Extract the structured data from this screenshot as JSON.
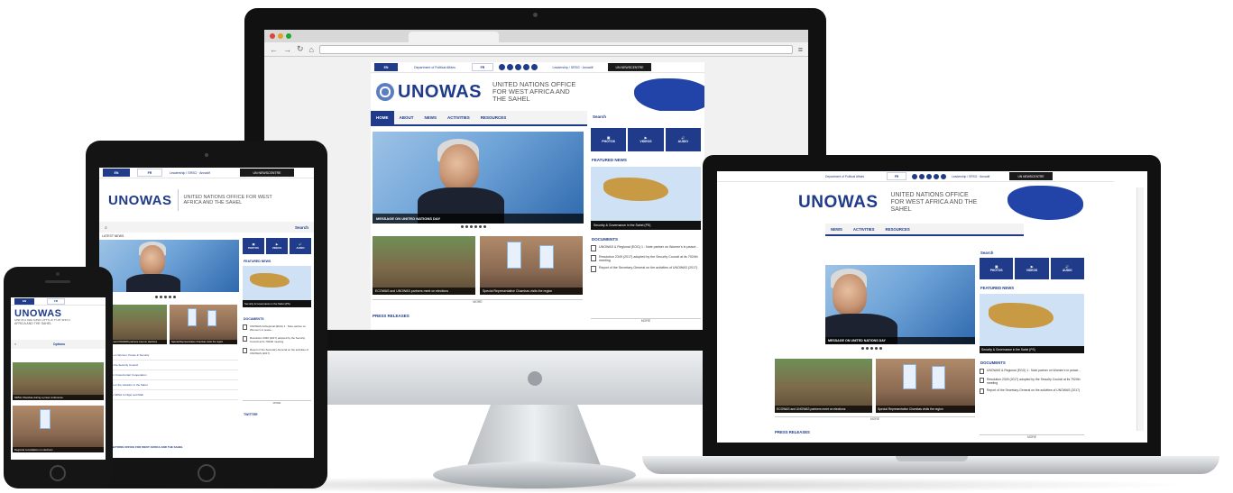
{
  "site": {
    "short_name": "UNOWAS",
    "full_name": "UNITED NATIONS OFFICE FOR WEST AFRICA AND THE SAHEL",
    "lang_en": "EN",
    "lang_fr": "FR",
    "leadership_link": "Leadership / SRSG · Annadif",
    "dark_button": "UN NEWSCENTRE",
    "relations_link": "Department of Political Affairs"
  },
  "nav": {
    "items": [
      "HOME",
      "ABOUT",
      "NEWS",
      "ACTIVITIES",
      "RESOURCES"
    ],
    "search_label": "Search"
  },
  "hero": {
    "caption": "MESSAGE ON UNITED NATIONS DAY",
    "ticker": "LATEST NEWS"
  },
  "icon_buttons": [
    "PHOTOS",
    "VIDEOS",
    "AUDIO"
  ],
  "featured": {
    "title": "FEATURED NEWS",
    "map_label": "Security & Governance in the Sahel (PS)",
    "map_tag": "FOCUS / PROJECTS"
  },
  "documents": {
    "title": "DOCUMENTS",
    "items": [
      "UNOWAS & Regional (EGG) 1 : Note partner on Women's in peace...",
      "Resolution 2349 (2017) adopted by the Security Council at its 7924th meeting",
      "Report of the Secretary-General on the activities of UNOWAS (2017)"
    ],
    "more": "MORE"
  },
  "thumbs": [
    "ECOWAS and UNOWAS partners meet on elections",
    "Special Representative Chambas visits the region"
  ],
  "press_title": "PRESS RELEASES",
  "more_label": "MORE",
  "tablet": {
    "menu_label": "Search",
    "list": [
      "Workshop on Women, Peace & Security",
      "Briefing to the Security Council",
      "Meeting on Cross-border Cooperation",
      "Statement on the situation in the Sahel",
      "Visit of the SRSG to Niger and Mali"
    ],
    "bottom_link": "UNITED NATIONS OFFICE FOR WEST AFRICA AND THE SAHEL",
    "twitter": "TWITTER"
  },
  "phone": {
    "menu_label": "Options",
    "caption_1": "SRSG Chambas during a press conference",
    "caption_2": "Regional consultation on elections"
  },
  "colors": {
    "brand_blue": "#1f3b8a",
    "map_land": "#c99a44"
  }
}
